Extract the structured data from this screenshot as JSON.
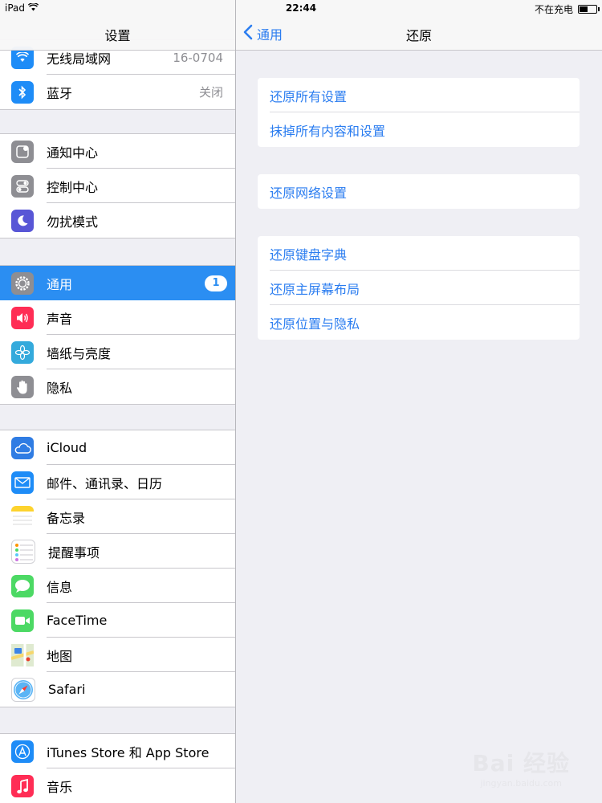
{
  "status_bar": {
    "device": "iPad",
    "time": "22:44",
    "charging": "不在充电",
    "battery_level": 0.55
  },
  "master": {
    "title": "设置",
    "groups": [
      [
        {
          "label": "无线局域网",
          "detail": "16-0704",
          "icon": "wifi-icon",
          "color": "#1e8cf7"
        },
        {
          "label": "蓝牙",
          "detail": "关闭",
          "icon": "bluetooth-icon",
          "color": "#1e8cf7"
        }
      ],
      [
        {
          "label": "通知中心",
          "icon": "notification-center-icon",
          "color": "#8e8e93"
        },
        {
          "label": "控制中心",
          "icon": "control-center-icon",
          "color": "#8e8e93"
        },
        {
          "label": "勿扰模式",
          "icon": "moon-icon",
          "color": "#5856d6"
        }
      ],
      [
        {
          "label": "通用",
          "badge": "1",
          "icon": "gear-icon",
          "color": "#8e8e93",
          "selected": true
        },
        {
          "label": "声音",
          "icon": "speaker-icon",
          "color": "#ff2d55"
        },
        {
          "label": "墙纸与亮度",
          "icon": "flower-icon",
          "color": "#34aadc"
        },
        {
          "label": "隐私",
          "icon": "hand-icon",
          "color": "#8e8e93"
        }
      ],
      [
        {
          "label": "iCloud",
          "icon": "cloud-icon",
          "color": "#2f7ce3"
        },
        {
          "label": "邮件、通讯录、日历",
          "icon": "mail-icon",
          "color": "#1e8cf7"
        },
        {
          "label": "备忘录",
          "icon": "notes-icon",
          "color": "#fdd32e"
        },
        {
          "label": "提醒事项",
          "icon": "reminders-icon",
          "color": "#ffffff"
        },
        {
          "label": "信息",
          "icon": "messages-icon",
          "color": "#4cd964"
        },
        {
          "label": "FaceTime",
          "icon": "facetime-icon",
          "color": "#4cd964"
        },
        {
          "label": "地图",
          "icon": "maps-icon",
          "color": "#e8f0d8"
        },
        {
          "label": "Safari",
          "icon": "safari-icon",
          "color": "#ffffff"
        }
      ],
      [
        {
          "label": "iTunes Store 和 App Store",
          "icon": "app-store-icon",
          "color": "#1e8cf7"
        },
        {
          "label": "音乐",
          "icon": "music-icon",
          "color": "#ff2d55"
        }
      ]
    ]
  },
  "detail": {
    "back_label": "通用",
    "title": "还原",
    "groups": [
      [
        "还原所有设置",
        "抹掉所有内容和设置"
      ],
      [
        "还原网络设置"
      ],
      [
        "还原键盘字典",
        "还原主屏幕布局",
        "还原位置与隐私"
      ]
    ]
  },
  "watermark": {
    "brand": "Bai 经验",
    "url": "jingyan.baidu.com"
  }
}
